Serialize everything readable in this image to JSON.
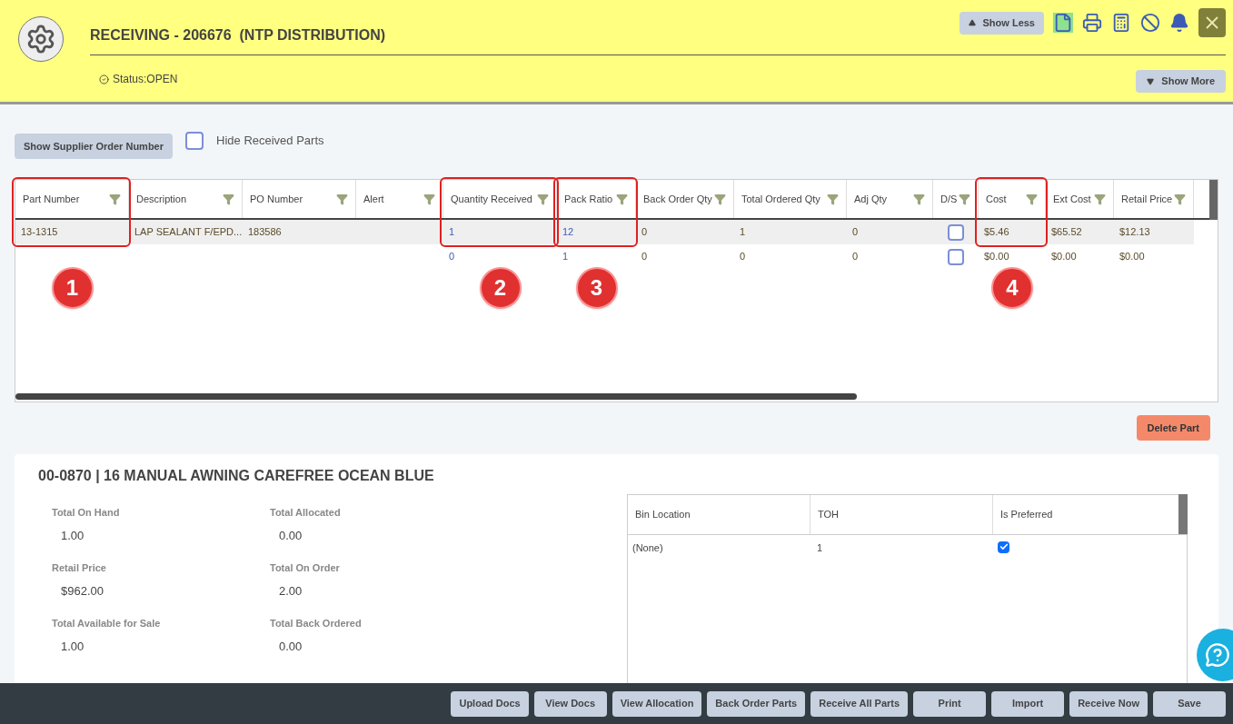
{
  "header": {
    "title": "RECEIVING - 206676  (NTP DISTRIBUTION)",
    "status": "Status:OPEN",
    "show_less": "Show Less",
    "show_more": "Show More"
  },
  "toolbar": {
    "show_supplier_button": "Show Supplier Order Number",
    "hide_received": {
      "label": "Hide Received Parts",
      "checked": false
    }
  },
  "grid": {
    "columns": [
      {
        "label": "Part Number",
        "kind": "text",
        "callout": "1"
      },
      {
        "label": "Description",
        "kind": "text"
      },
      {
        "label": "PO Number",
        "kind": "text"
      },
      {
        "label": "Alert",
        "kind": "text"
      },
      {
        "label": "Quantity Received",
        "kind": "link",
        "callout": "2"
      },
      {
        "label": "Pack Ratio",
        "kind": "link",
        "callout": "3"
      },
      {
        "label": "Back Order Qty",
        "kind": "text"
      },
      {
        "label": "Total Ordered Qty",
        "kind": "text"
      },
      {
        "label": "Adj Qty",
        "kind": "text"
      },
      {
        "label": "D/S",
        "kind": "checkbox"
      },
      {
        "label": "Cost",
        "kind": "text",
        "callout": "4"
      },
      {
        "label": "Ext Cost",
        "kind": "text"
      },
      {
        "label": "Retail Price",
        "kind": "text"
      }
    ],
    "rows": [
      {
        "selected": true,
        "cells": [
          "13-1315",
          "LAP SEALANT F/EPD...",
          "183586",
          "",
          "1",
          "12",
          "0",
          "1",
          "0",
          false,
          "$5.46",
          "$65.52",
          "$12.13"
        ]
      },
      {
        "selected": false,
        "cells": [
          "",
          "",
          "",
          "",
          "0",
          "1",
          "0",
          "0",
          "0",
          false,
          "$0.00",
          "$0.00",
          "$0.00"
        ]
      }
    ]
  },
  "delete_button": "Delete Part",
  "detail": {
    "title": "00-0870 | 16 MANUAL AWNING CAREFREE OCEAN BLUE",
    "fields": [
      {
        "label": "Total On Hand",
        "value": "1.00"
      },
      {
        "label": "Total Allocated",
        "value": "0.00"
      },
      {
        "label": "Retail Price",
        "value": "$962.00"
      },
      {
        "label": "Total On Order",
        "value": "2.00"
      },
      {
        "label": "Total Available for Sale",
        "value": "1.00"
      },
      {
        "label": "Total Back Ordered",
        "value": "0.00"
      }
    ],
    "bins": {
      "columns": [
        "Bin Location",
        "TOH",
        "Is Preferred"
      ],
      "rows": [
        {
          "bin": "(None)",
          "toh": "1",
          "preferred": true
        }
      ]
    }
  },
  "footer_buttons": [
    "Upload Docs",
    "View Docs",
    "View Allocation",
    "Back Order Parts",
    "Receive All Parts",
    "Print",
    "Import",
    "Receive Now",
    "Save"
  ]
}
